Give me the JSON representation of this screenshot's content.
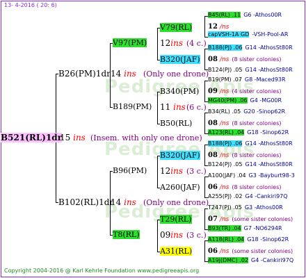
{
  "header": "13- 4-2016 ( 20: 6)",
  "footer": "Copyright 2004-2016 @ Karl Kehrle Foundation    www.pedigreeapis.org",
  "watermark": "Pedigree Apis",
  "root": {
    "label": "B521(RL)1dr",
    "year": "15",
    "ins": "ins",
    "note": "(Insem. with only one drone)"
  },
  "gen1": [
    {
      "label": "B26(PM)1dr",
      "year": "14",
      "ins": "ins",
      "note": "(Only one drone)"
    },
    {
      "label": "B102(RL)1dr",
      "year": "14",
      "ins": "ins",
      "note": "(Only one drone)"
    }
  ],
  "gen2": [
    {
      "label": "V97(PM)",
      "year": "12",
      "ins": "ins",
      "note": "(4 c.)"
    },
    {
      "label": "B189(PM)",
      "year": "11",
      "ins": "ins",
      "note": "(6 c.)"
    },
    {
      "label": "B96(PM)",
      "year": "12",
      "ins": "ins",
      "note": "(3 c.)"
    },
    {
      "label": "T8(RL)",
      "year": "09",
      "ins": "ins",
      "note": "(3 c.)"
    }
  ],
  "gen3": [
    {
      "label": "V79(RL)"
    },
    {
      "label": "B320(JAF)"
    },
    {
      "label": "B340(PM)"
    },
    {
      "label": "B50(RL)"
    },
    {
      "label": "B320(JAF)"
    },
    {
      "label": "A260(JAF)"
    },
    {
      "label": "T29(RL)"
    },
    {
      "label": "A31(RL)"
    }
  ],
  "gen4": [
    {
      "label": "B45(RL) .11",
      "breeder": "G6 -Athos00R"
    },
    {
      "label": "12",
      "ins": "/ns",
      "breeder": ""
    },
    {
      "label": "capVSH-1A GD",
      "breeder": "-VSH-Pool-AR"
    },
    {
      "label": "B188(PJ) .06",
      "breeder": "G14 -AthosSt80R"
    },
    {
      "label": "08",
      "ins": "/ns",
      "breeder": "(8 sister colonies)"
    },
    {
      "label": "B124(PJ) .05",
      "breeder": "G14 -AthosSt80R"
    },
    {
      "label": "B19(PM) .07",
      "breeder": "G8 -Maced93R"
    },
    {
      "label": "09",
      "ins": "/ns",
      "breeder": "(4 sister colonies)"
    },
    {
      "label": "MG40(PM) .06",
      "breeder": "G4 -MG00R"
    },
    {
      "label": "B34(RL) .05",
      "breeder": "G20 -Sinop62R"
    },
    {
      "label": "08",
      "ins": "/ns",
      "breeder": "(8 sister colonies)"
    },
    {
      "label": "A123(RL) .04",
      "breeder": "G18 -Sinop62R"
    },
    {
      "label": "B188(PJ) .06",
      "breeder": "G14 -AthosSt80R"
    },
    {
      "label": "08",
      "ins": "/ns",
      "breeder": "(8 sister colonies)"
    },
    {
      "label": "B124(PJ) .05",
      "breeder": "G14 -AthosSt80R"
    },
    {
      "label": "A100(JAF) .04",
      "breeder": "G3 -Bayburt98-3"
    },
    {
      "label": "06",
      "ins": "/ns",
      "breeder": "(8 sister colonies)"
    },
    {
      "label": "A255(PJ) .02",
      "breeder": "G4 -Cankiri97Q"
    },
    {
      "label": "T247(PJ) .05",
      "breeder": "G3 -Athos00R"
    },
    {
      "label": "07",
      "ins": "/ns",
      "breeder": "(some sister colonies)"
    },
    {
      "label": "B93(TR) .04",
      "breeder": "G7 -NO6294R"
    },
    {
      "label": "A118(RL) .04",
      "breeder": "G18 -Sinop62R"
    },
    {
      "label": "06",
      "ins": "/ns",
      "breeder": "(some sister colonies)"
    },
    {
      "label": "A19j(DMC) .02",
      "breeder": "G4 -Cankiri97Q"
    }
  ],
  "colors": {
    "frame": "#8a2be2",
    "green": "#2ee02e",
    "cyan": "#3ee0ff",
    "yellow": "#ffff00",
    "pink": "#ffc0ff",
    "ins": "#ff0000",
    "note": "#800080",
    "breeder": "#0000a0"
  }
}
